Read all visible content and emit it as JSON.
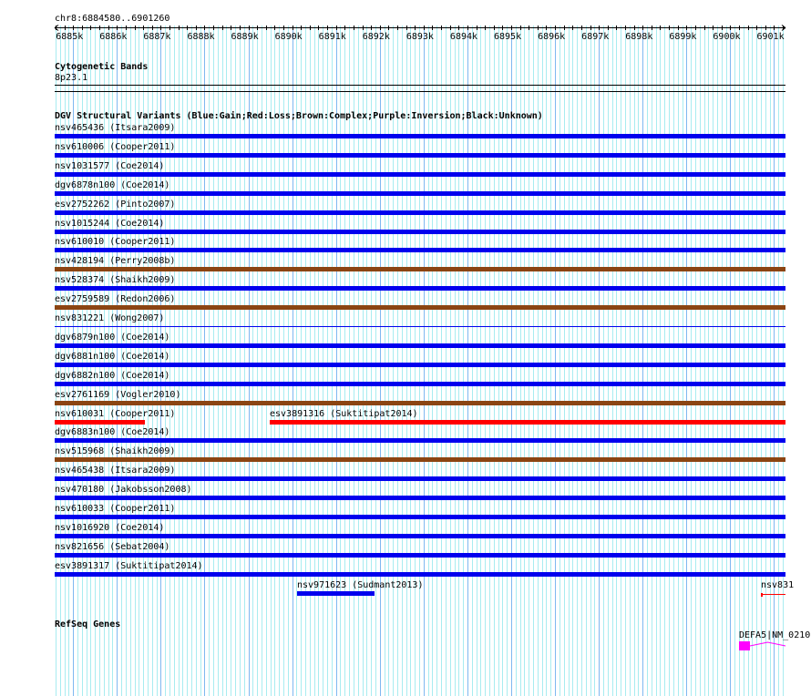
{
  "view": {
    "chrom": "chr8",
    "start": 6884580,
    "end": 6901260,
    "label": "chr8:6884580..6901260"
  },
  "ruler": {
    "ticks": [
      "6885k",
      "6886k",
      "6887k",
      "6888k",
      "6889k",
      "6890k",
      "6891k",
      "6892k",
      "6893k",
      "6894k",
      "6895k",
      "6896k",
      "6897k",
      "6898k",
      "6899k",
      "6900k",
      "6901k"
    ]
  },
  "cytoband": {
    "title": "Cytogenetic Bands",
    "band": "8p23.1"
  },
  "dgv": {
    "title": "DGV Structural Variants (Blue:Gain;Red:Loss;Brown:Complex;Purple:Inversion;Black:Unknown)",
    "colors": {
      "gain": "#0000ee",
      "loss": "#ff0000",
      "complex": "#8b4513"
    },
    "rows": [
      [
        {
          "label": "nsv465436 (Itsara2009)",
          "type": "gain",
          "start": 6884580,
          "end": 6901260
        }
      ],
      [
        {
          "label": "nsv610006 (Cooper2011)",
          "type": "gain",
          "start": 6884580,
          "end": 6901260
        }
      ],
      [
        {
          "label": "nsv1031577 (Coe2014)",
          "type": "gain",
          "start": 6884580,
          "end": 6901260
        }
      ],
      [
        {
          "label": "dgv6878n100 (Coe2014)",
          "type": "gain",
          "start": 6884580,
          "end": 6901260
        }
      ],
      [
        {
          "label": "esv2752262 (Pinto2007)",
          "type": "gain",
          "start": 6884580,
          "end": 6901260
        }
      ],
      [
        {
          "label": "nsv1015244 (Coe2014)",
          "type": "gain",
          "start": 6884580,
          "end": 6901260
        }
      ],
      [
        {
          "label": "nsv610010 (Cooper2011)",
          "type": "gain",
          "start": 6884580,
          "end": 6901260
        }
      ],
      [
        {
          "label": "nsv428194 (Perry2008b)",
          "type": "complex",
          "start": 6884580,
          "end": 6901260
        }
      ],
      [
        {
          "label": "nsv528374 (Shaikh2009)",
          "type": "gain",
          "start": 6884580,
          "end": 6901260
        }
      ],
      [
        {
          "label": "esv2759589 (Redon2006)",
          "type": "complex",
          "start": 6884580,
          "end": 6901260
        }
      ],
      [
        {
          "label": "nsv831221 (Wong2007)",
          "type": "gain",
          "thin": true,
          "start": 6884580,
          "end": 6901260
        }
      ],
      [
        {
          "label": "dgv6879n100 (Coe2014)",
          "type": "gain",
          "start": 6884580,
          "end": 6901260
        }
      ],
      [
        {
          "label": "dgv6881n100 (Coe2014)",
          "type": "gain",
          "start": 6884580,
          "end": 6901260
        }
      ],
      [
        {
          "label": "dgv6882n100 (Coe2014)",
          "type": "gain",
          "start": 6884580,
          "end": 6901260
        }
      ],
      [
        {
          "label": "esv2761169 (Vogler2010)",
          "type": "complex",
          "start": 6884580,
          "end": 6901260
        }
      ],
      [
        {
          "label": "nsv610031 (Cooper2011)",
          "type": "loss",
          "start": 6884580,
          "end": 6886640
        },
        {
          "label": "esv3891316 (Suktitipat2014)",
          "type": "loss",
          "start": 6889490,
          "end": 6901260
        }
      ],
      [
        {
          "label": "dgv6883n100 (Coe2014)",
          "type": "gain",
          "start": 6884580,
          "end": 6901260
        }
      ],
      [
        {
          "label": "nsv515968 (Shaikh2009)",
          "type": "complex",
          "start": 6884580,
          "end": 6901260
        }
      ],
      [
        {
          "label": "nsv465438 (Itsara2009)",
          "type": "gain",
          "start": 6884580,
          "end": 6901260
        }
      ],
      [
        {
          "label": "nsv470180 (Jakobsson2008)",
          "type": "gain",
          "start": 6884580,
          "end": 6901260
        }
      ],
      [
        {
          "label": "nsv610033 (Cooper2011)",
          "type": "gain",
          "start": 6884580,
          "end": 6901260
        }
      ],
      [
        {
          "label": "nsv1016920 (Coe2014)",
          "type": "gain",
          "start": 6884580,
          "end": 6901260
        }
      ],
      [
        {
          "label": "nsv821656 (Sebat2004)",
          "type": "gain",
          "start": 6884580,
          "end": 6901260
        }
      ],
      [
        {
          "label": "esv3891317 (Suktitipat2014)",
          "type": "gain",
          "start": 6884580,
          "end": 6901260
        }
      ],
      [
        {
          "label": "nsv971623 (Sudmant2013)",
          "type": "gain",
          "start": 6890112,
          "end": 6891880
        },
        {
          "label": "nsv831",
          "type": "loss",
          "tick": true,
          "start": 6900695,
          "end": 6901260
        }
      ]
    ]
  },
  "refseq": {
    "title": "RefSeq Genes",
    "gene": {
      "label": "DEFA5|NM_0210",
      "start": 6900200,
      "end": 6901260,
      "color": "#ff00ff"
    }
  }
}
